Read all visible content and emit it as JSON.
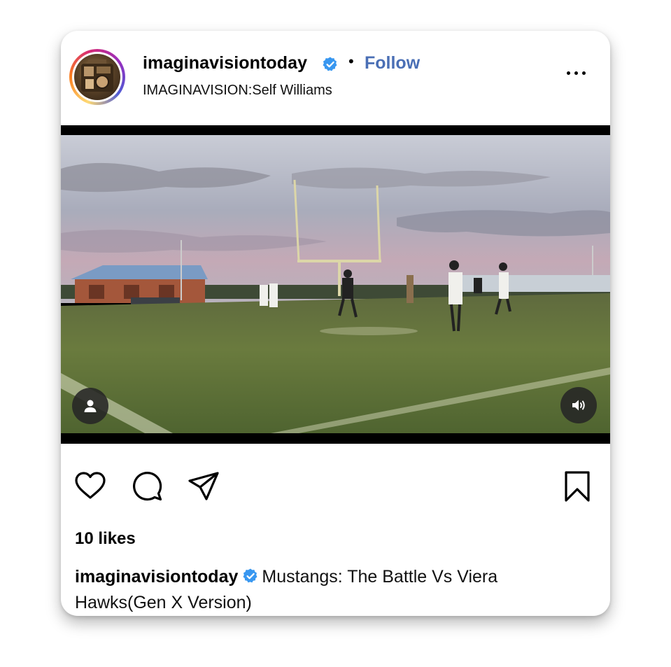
{
  "post": {
    "username": "imaginavisiontoday",
    "separator": "•",
    "follow_label": "Follow",
    "subtitle": "IMAGINAVISION:Self Williams",
    "more_icon": "ellipsis-icon",
    "verified_color": "#3897f0",
    "follow_color": "#4a6fb5"
  },
  "video": {
    "description": "football game at dusk",
    "tag_icon": "person-icon",
    "sound_icon": "speaker-icon"
  },
  "actions": {
    "like_icon": "heart-icon",
    "comment_icon": "comment-icon",
    "share_icon": "send-icon",
    "save_icon": "bookmark-icon"
  },
  "likes": "10 likes",
  "caption": {
    "username": "imaginavisiontoday",
    "text": "Mustangs: The Battle Vs Viera Hawks(Gen X Version)"
  }
}
